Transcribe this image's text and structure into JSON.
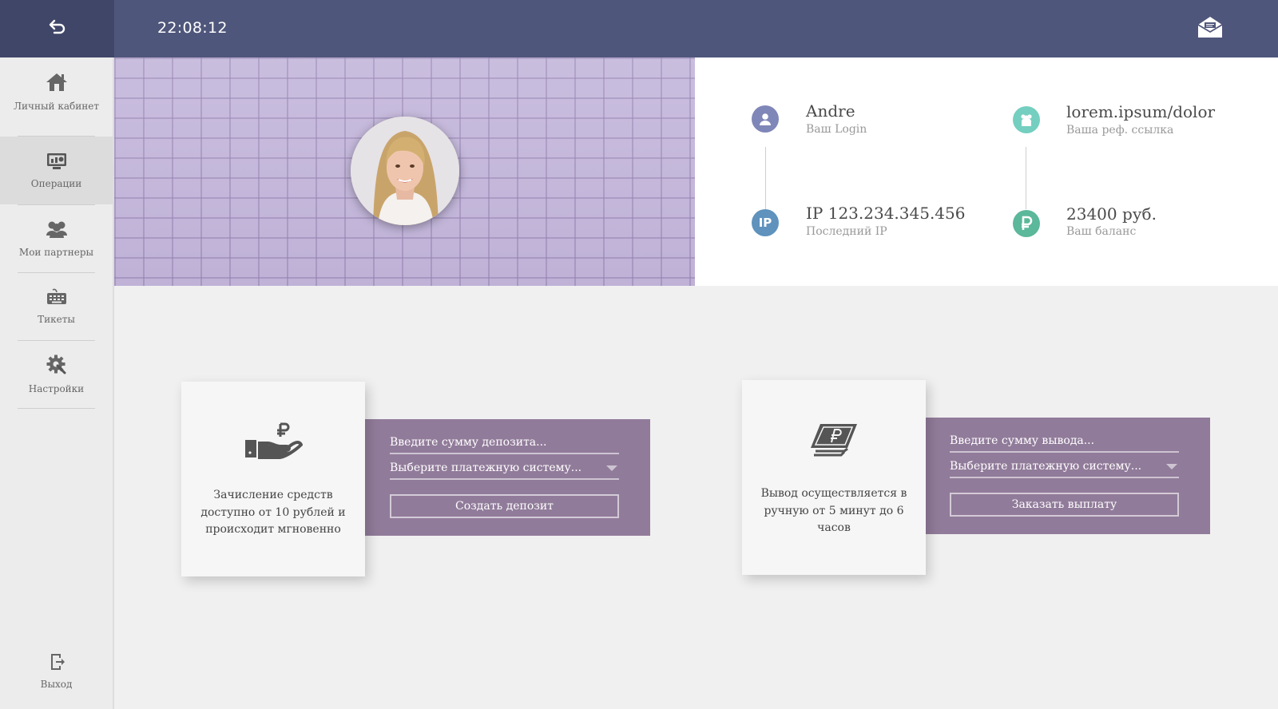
{
  "header": {
    "time": "22:08:12",
    "back_icon": "undo-arrow-icon",
    "mail_icon": "envelope-icon"
  },
  "sidebar": {
    "items": [
      {
        "label": "Личный кабинет",
        "icon": "home-icon",
        "active": false
      },
      {
        "label": "Операции",
        "icon": "monitor-chart-icon",
        "active": true
      },
      {
        "label": "Мои партнеры",
        "icon": "users-icon",
        "active": false
      },
      {
        "label": "Тикеты",
        "icon": "keyboard-icon",
        "active": false
      },
      {
        "label": "Настройки",
        "icon": "gear-wrench-icon",
        "active": false
      }
    ],
    "logout": {
      "label": "Выход",
      "icon": "exit-icon"
    }
  },
  "profile": {
    "login_value": "Andre",
    "login_caption": "Ваш Login",
    "ref_value": "lorem.ipsum/dolor",
    "ref_caption": "Ваша реф. ссылка",
    "ip_value": "IP 123.234.345.456",
    "ip_caption": "Последний IP",
    "balance_value": "23400 руб.",
    "balance_caption": "Ваш баланс",
    "ip_badge": "IP",
    "colors": {
      "login": "#7f86b8",
      "ref": "#74cfc0",
      "ip": "#5f92bd",
      "balance": "#5bb89a"
    }
  },
  "deposit": {
    "description": "Зачисление средств доступно от 10 рублей и происходит мгновенно",
    "amount_placeholder": "Введите сумму депозита...",
    "system_placeholder": "Выберите платежную систему...",
    "button": "Создать депозит",
    "icon": "hand-ruble-icon"
  },
  "withdraw": {
    "description": "Вывод осуществляется в ручную от 5 минут до 6 часов",
    "amount_placeholder": "Введите сумму вывода...",
    "system_placeholder": "Выберите платежную систему...",
    "button": "Заказать выплату",
    "icon": "banknote-ruble-icon"
  },
  "colors": {
    "topbar": "#4f567b",
    "panel": "#917b9a"
  }
}
